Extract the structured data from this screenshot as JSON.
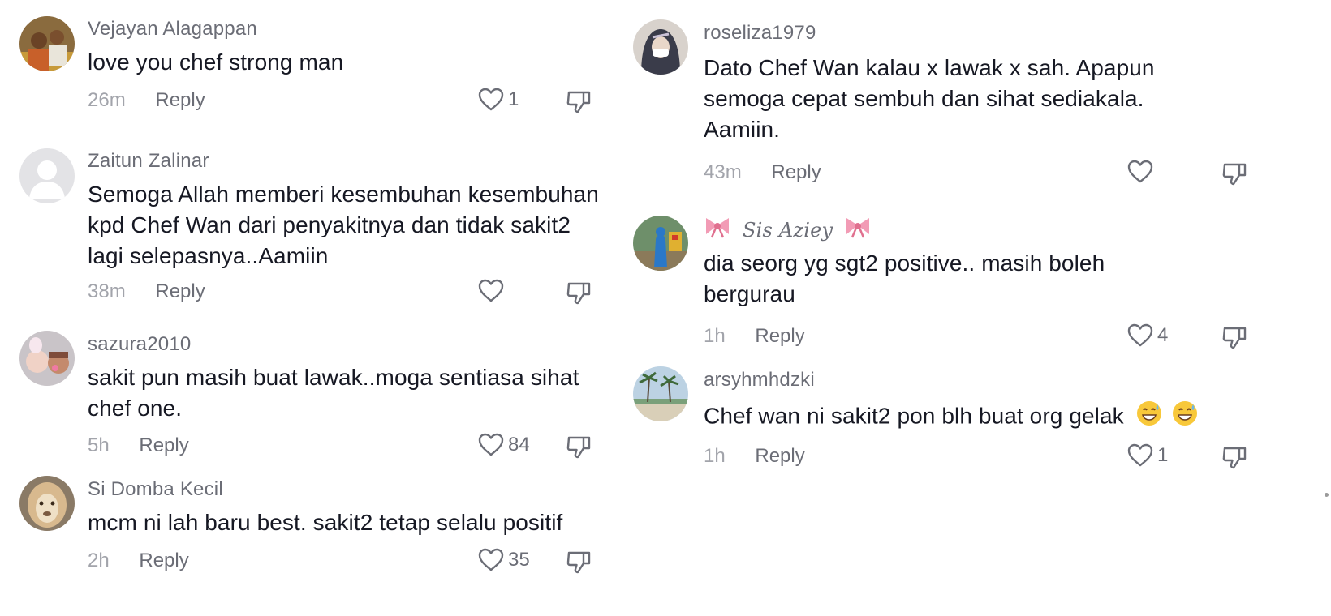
{
  "left_column": [
    {
      "username": "Vejayan Alagappan",
      "text": "love you chef strong man",
      "time": "26m",
      "reply": "Reply",
      "likes": "1"
    },
    {
      "username": "Zaitun Zalinar",
      "text": "Semoga Allah memberi kesembuhan kesembuhan kpd Chef Wan dari penyakitnya dan tidak sakit2 lagi selepasnya..Aamiin",
      "time": "38m",
      "reply": "Reply",
      "likes": ""
    },
    {
      "username": "sazura2010",
      "text": "sakit pun masih buat lawak..moga sentiasa sihat chef one.",
      "time": "5h",
      "reply": "Reply",
      "likes": "84"
    },
    {
      "username": "Si Domba Kecil",
      "text": "mcm ni lah baru best. sakit2 tetap selalu positif",
      "time": "2h",
      "reply": "Reply",
      "likes": "35"
    }
  ],
  "right_column": [
    {
      "username": "roseliza1979",
      "text": "Dato Chef Wan kalau x lawak x sah. Apapun semoga cepat sembuh dan sihat sediakala. Aamiin.",
      "time": "43m",
      "reply": "Reply",
      "likes": ""
    },
    {
      "username": "Sis Aziey",
      "text": "dia seorg yg sgt2 positive.. masih boleh bergurau",
      "time": "1h",
      "reply": "Reply",
      "likes": "4"
    },
    {
      "username": "arsyhmhdzki",
      "text": "Chef wan ni sakit2 pon blh buat org gelak",
      "time": "1h",
      "reply": "Reply",
      "likes": "1"
    }
  ],
  "icons": {
    "like": "heart-outline-icon",
    "dislike": "thumbs-down-outline-icon",
    "bow": "ribbon-bow-emoji",
    "sweat_smile": "grinning-face-with-sweat-emoji"
  },
  "colors": {
    "text": "#161823",
    "username": "#6b6d76",
    "time": "#a2a4ab",
    "icon": "#6b6d76",
    "bow": "#f29bb5"
  }
}
